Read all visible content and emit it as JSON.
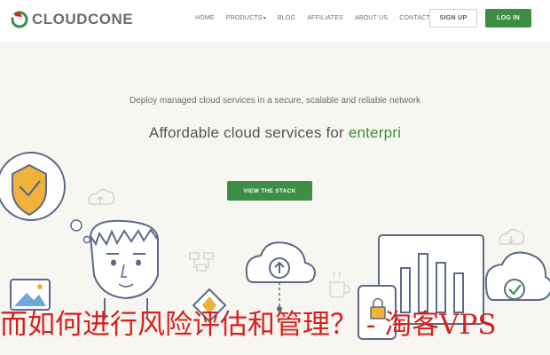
{
  "brand": {
    "name": "CLOUDCONE"
  },
  "nav": {
    "items": [
      "HOME",
      "PRODUCTS",
      "BLOG",
      "AFFILIATES",
      "ABOUT US",
      "CONTACT"
    ],
    "signup": "SIGN UP",
    "login": "LOG IN"
  },
  "hero": {
    "tagline": "Deploy managed cloud services in a secure, scalable and reliable network",
    "headline_prefix": "Affordable cloud services for ",
    "headline_highlight": "enterpri",
    "cta": "VIEW THE STACK"
  },
  "overlay_text": "而如何进行风险评估和管理？ - 淘客VPS",
  "colors": {
    "accent": "#3b8e43",
    "background": "#f7f6f1",
    "overlay": "#d8201e",
    "shield": "#f0b23a"
  }
}
